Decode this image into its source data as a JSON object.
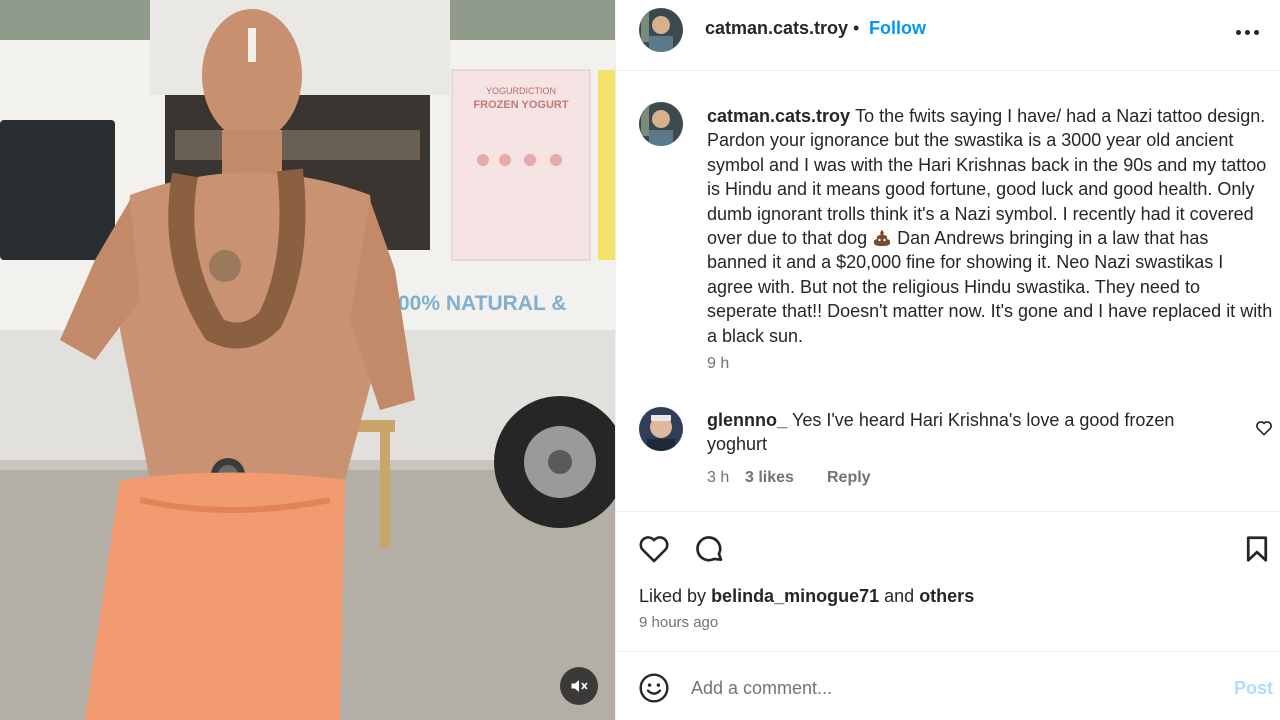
{
  "post": {
    "username": "catman.cats.troy",
    "separator": "•",
    "follow_label": "Follow",
    "more_icon": "more-options-icon"
  },
  "media": {
    "van_sign_1": "YOGURDICTION",
    "van_sign_2": "FROZEN YOGURT",
    "van_side_text": "00% NATURAL &",
    "mute_icon": "speaker-muted-icon"
  },
  "caption": {
    "username": "catman.cats.troy",
    "text_part1": "To the fwits saying I have/ had a Nazi tattoo design. Pardon your ignorance but the swastika is a 3000 year old ancient symbol and I was with the Hari Krishnas back in the 90s and my tattoo is Hindu and it means good fortune, good luck and good health. Only dumb ignorant trolls think it's a Nazi symbol. I recently had it covered over due to that dog",
    "text_part2": "Dan Andrews bringing in a law that has banned it and a $20,000 fine for showing it. Neo Nazi swastikas I agree with. But not the religious Hindu swastika. They need to seperate that!! Doesn't matter now. It's gone and I have replaced it with a black sun.",
    "emoji": "poop-emoji",
    "time": "9 h"
  },
  "comments": [
    {
      "username": "glennno_",
      "text": "Yes I've heard Hari Krishna's love a good frozen yoghurt",
      "time": "3 h",
      "likes": "3 likes",
      "reply_label": "Reply"
    }
  ],
  "actions": {
    "like_icon": "heart-icon",
    "comment_icon": "comment-icon",
    "save_icon": "bookmark-icon"
  },
  "likes": {
    "prefix": "Liked by",
    "user": "belinda_minogue71",
    "conjunction": "and",
    "others": "others"
  },
  "post_time": "9 hours ago",
  "add_comment": {
    "placeholder": "Add a comment...",
    "post_label": "Post",
    "emoji_icon": "smiley-icon"
  },
  "colors": {
    "link_blue": "#0095f6",
    "post_disabled": "#b3dbff",
    "text_primary": "#262626",
    "text_secondary": "#737373",
    "border": "#efefef"
  }
}
